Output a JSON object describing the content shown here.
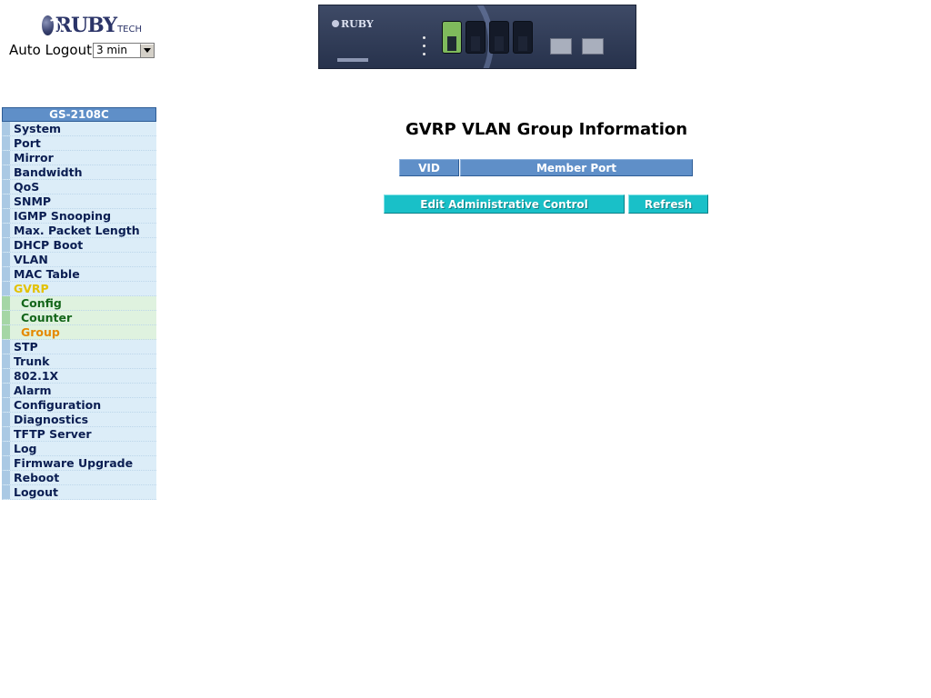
{
  "header": {
    "logo_text": "RUBY",
    "logo_sub": "TECH",
    "auto_logout_label": "Auto Logout",
    "auto_logout_value": "3 min"
  },
  "device": {
    "model_label": "RUBY",
    "active_port": 1,
    "port_count": 4,
    "sfp_count": 2
  },
  "sidebar": {
    "title": "GS-2108C",
    "items": [
      {
        "label": "System"
      },
      {
        "label": "Port"
      },
      {
        "label": "Mirror"
      },
      {
        "label": "Bandwidth"
      },
      {
        "label": "QoS"
      },
      {
        "label": "SNMP"
      },
      {
        "label": "IGMP Snooping"
      },
      {
        "label": "Max. Packet Length"
      },
      {
        "label": "DHCP Boot"
      },
      {
        "label": "VLAN"
      },
      {
        "label": "MAC Table"
      },
      {
        "label": "GVRP"
      },
      {
        "label": "Config"
      },
      {
        "label": "Counter"
      },
      {
        "label": "Group"
      },
      {
        "label": "STP"
      },
      {
        "label": "Trunk"
      },
      {
        "label": "802.1X"
      },
      {
        "label": "Alarm"
      },
      {
        "label": "Configuration"
      },
      {
        "label": "Diagnostics"
      },
      {
        "label": "TFTP Server"
      },
      {
        "label": "Log"
      },
      {
        "label": "Firmware Upgrade"
      },
      {
        "label": "Reboot"
      },
      {
        "label": "Logout"
      }
    ]
  },
  "main": {
    "title": "GVRP VLAN Group Information",
    "table": {
      "columns": [
        "VID",
        "Member Port"
      ]
    },
    "buttons": {
      "edit": "Edit Administrative Control",
      "refresh": "Refresh"
    }
  },
  "colors": {
    "header_blue": "#5f8fc8",
    "menu_bg": "#dcedf8",
    "submenu_bg": "#dff2df",
    "active_menu": "#e3c100",
    "current_submenu": "#e58a00",
    "button_cyan": "#19c0c8"
  }
}
